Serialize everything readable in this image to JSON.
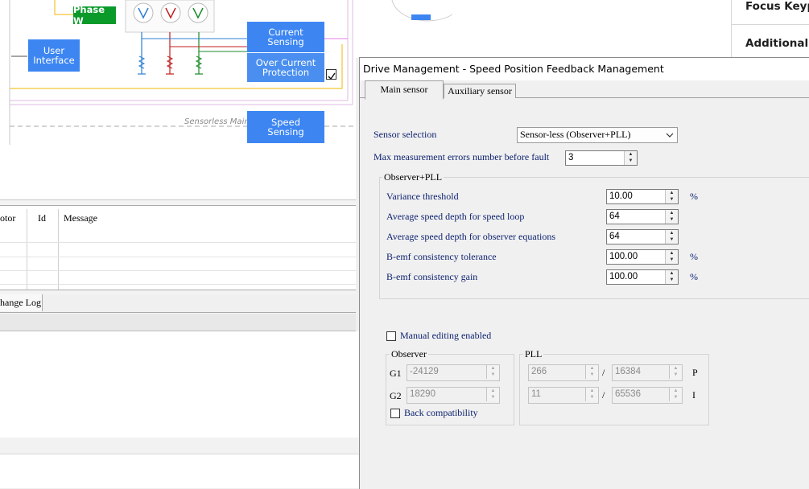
{
  "diagram": {
    "phase_w": "Phase W",
    "user_interface": "User\nInterface",
    "current_sensing": "Current\nSensing",
    "over_current": "Over Current\nProtection",
    "sensorless_label": "Sensorless Main",
    "speed_sensing": "Speed\nSensing"
  },
  "log": {
    "columns": [
      "otor",
      "Id",
      "Message"
    ],
    "tab_label": "hange Log"
  },
  "right_panel": {
    "items": [
      "Focus Keyph",
      "Additional K"
    ]
  },
  "dialog": {
    "title": "Drive Management - Speed Position Feedback Management",
    "tabs": [
      "Main sensor",
      "Auxiliary sensor"
    ],
    "sensor_selection": {
      "label": "Sensor selection",
      "value": "Sensor-less (Observer+PLL)"
    },
    "max_errors": {
      "label": "Max measurement errors number before fault",
      "value": "3"
    },
    "observer_pll": {
      "title": "Observer+PLL",
      "fields": [
        {
          "label": "Variance threshold",
          "value": "10.00",
          "unit": "%"
        },
        {
          "label": "Average speed depth for speed loop",
          "value": "64",
          "unit": ""
        },
        {
          "label": "Average speed depth for observer equations",
          "value": "64",
          "unit": ""
        },
        {
          "label": "B-emf consistency tolerance",
          "value": "100.00",
          "unit": "%"
        },
        {
          "label": "B-emf consistency gain",
          "value": "100.00",
          "unit": "%"
        }
      ]
    },
    "manual_editing": "Manual editing enabled",
    "observer": {
      "title": "Observer",
      "g1_label": "G1",
      "g1_value": "-24129",
      "g2_label": "G2",
      "g2_value": "18290",
      "back_compat": "Back compatibility"
    },
    "pll": {
      "title": "PLL",
      "p_num": "266",
      "p_den": "16384",
      "p_label": "P",
      "i_num": "11",
      "i_den": "65536",
      "i_label": "I",
      "slash": "/"
    }
  }
}
